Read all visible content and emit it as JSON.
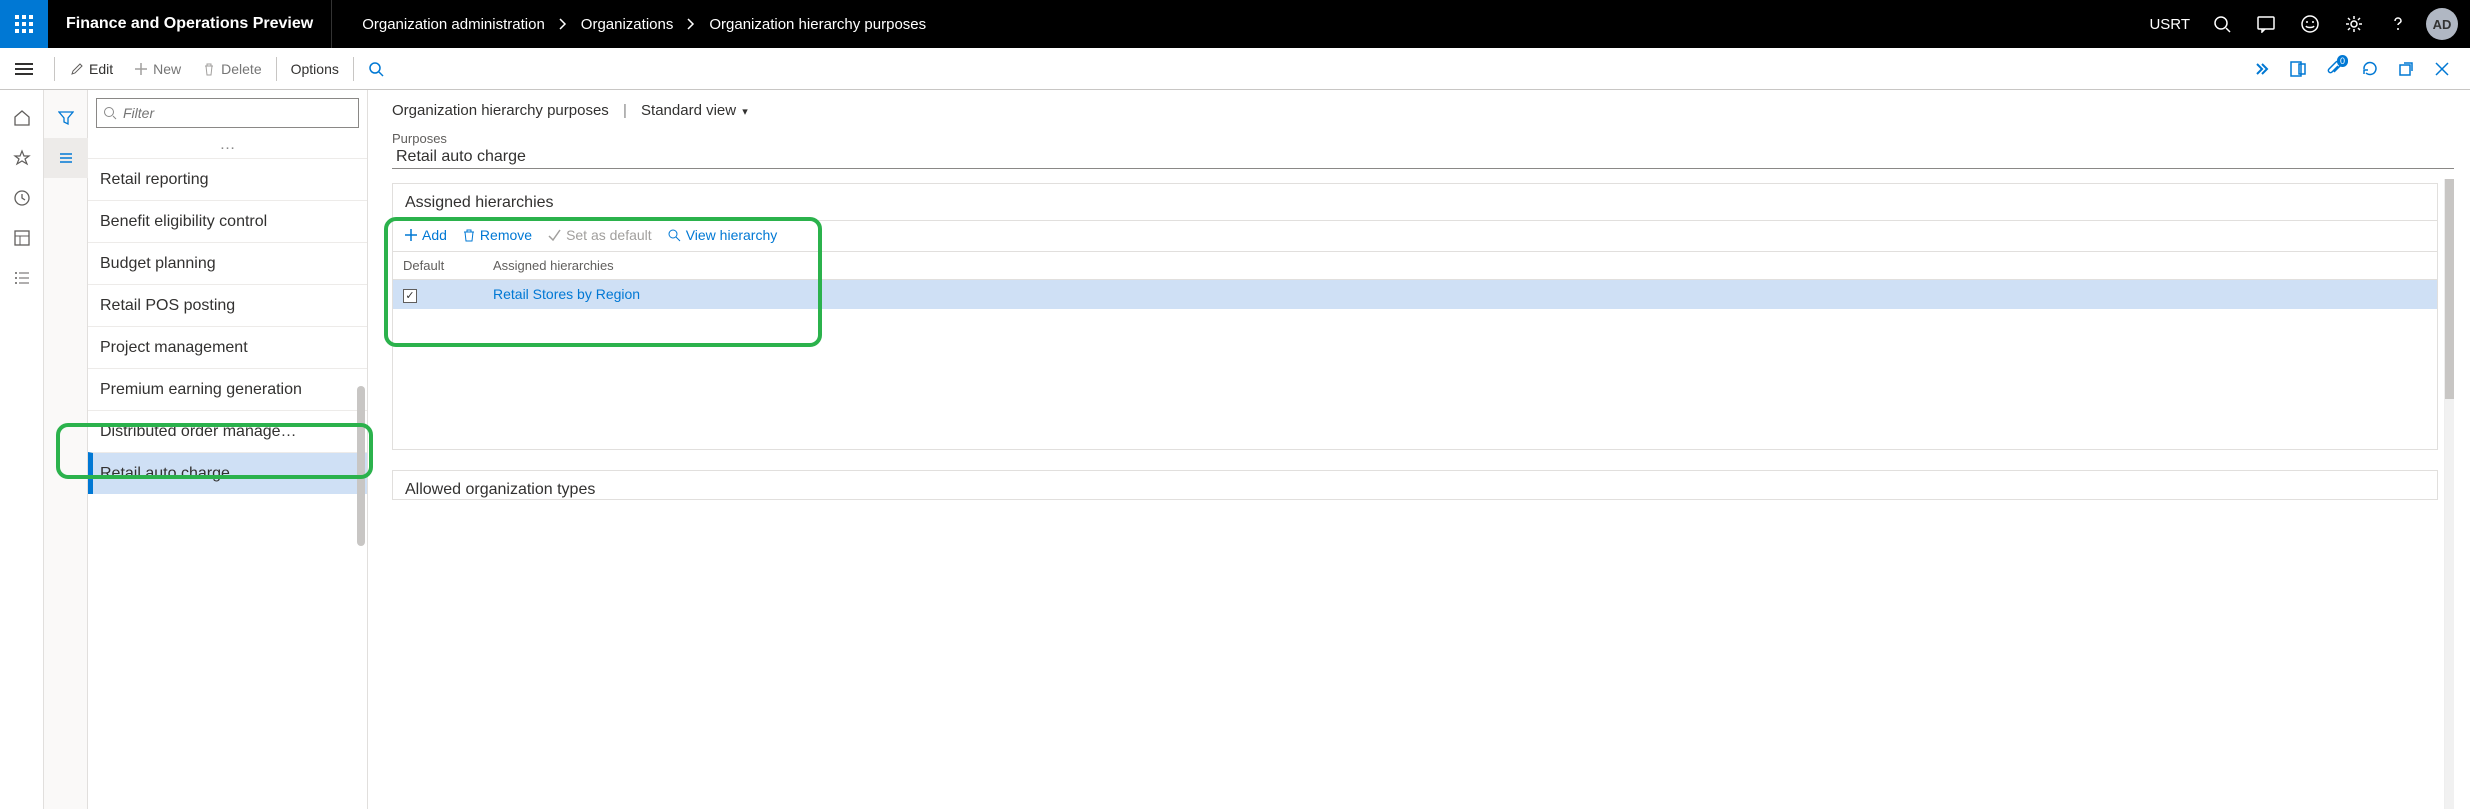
{
  "header": {
    "app_name": "Finance and Operations Preview",
    "breadcrumb": [
      "Organization administration",
      "Organizations",
      "Organization hierarchy purposes"
    ],
    "entity": "USRT",
    "avatar": "AD"
  },
  "cmdbar": {
    "edit": "Edit",
    "new": "New",
    "delete": "Delete",
    "options": "Options"
  },
  "sidelist": {
    "filter_placeholder": "Filter",
    "ellipsis": "…",
    "items": [
      "Retail reporting",
      "Benefit eligibility control",
      "Budget planning",
      "Retail POS posting",
      "Project management",
      "Premium earning generation",
      "Distributed order manage…",
      "Retail auto charge"
    ],
    "selected_index": 7
  },
  "main": {
    "title": "Organization hierarchy purposes",
    "view_label": "Standard view",
    "purpose_label": "Purposes",
    "purpose_value": "Retail auto charge",
    "panel_title": "Assigned hierarchies",
    "toolbar": {
      "add": "Add",
      "remove": "Remove",
      "set_default": "Set as default",
      "view_hierarchy": "View hierarchy"
    },
    "columns": {
      "default": "Default",
      "assigned": "Assigned hierarchies"
    },
    "rows": [
      {
        "default": true,
        "name": "Retail Stores by Region"
      }
    ],
    "panel2_title": "Allowed organization types"
  }
}
